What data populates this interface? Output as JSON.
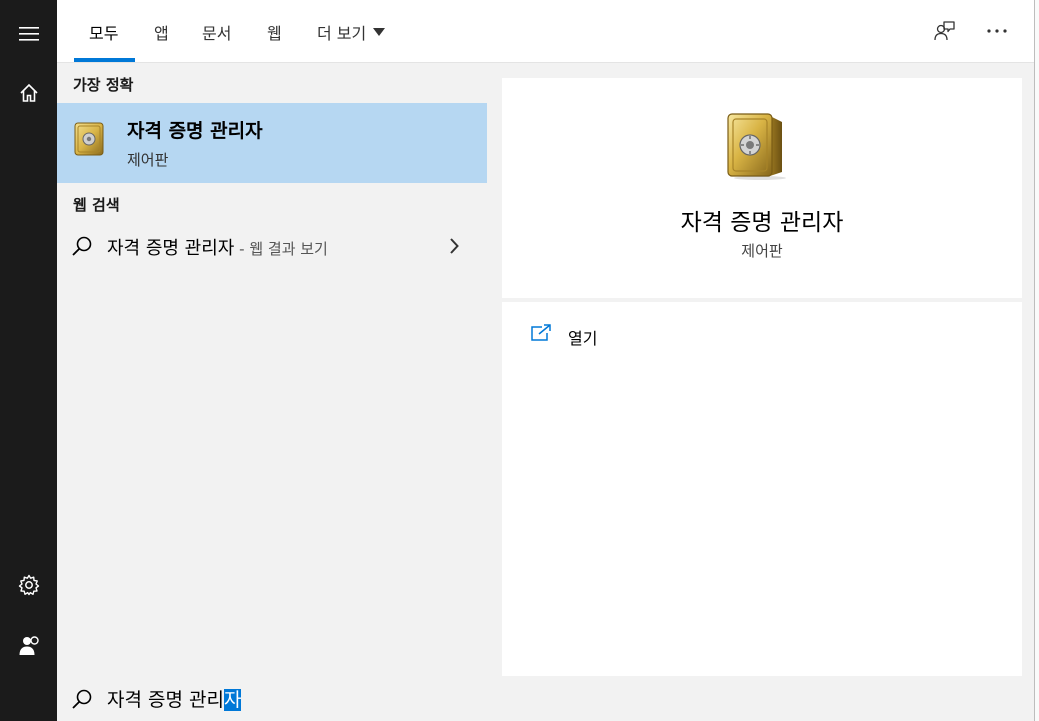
{
  "tabs": [
    {
      "label": "모두"
    },
    {
      "label": "앱"
    },
    {
      "label": "문서"
    },
    {
      "label": "웹"
    },
    {
      "label": "더 보기"
    }
  ],
  "results": {
    "best_match_header": "가장 정확",
    "best_match": {
      "title": "자격 증명 관리자",
      "subtitle": "제어판"
    },
    "web_header": "웹 검색",
    "web_result": {
      "query": "자격 증명 관리자",
      "suffix": " - 웹 결과 보기"
    }
  },
  "detail": {
    "name": "자격 증명 관리자",
    "category": "제어판",
    "actions": [
      {
        "label": "열기"
      }
    ]
  },
  "search": {
    "query_prefix": "자격 증명 관리",
    "query_selected": "자"
  },
  "colors": {
    "accent": "#0078d7",
    "selected_row": "#b6d7f2",
    "rail": "#1b1b1b"
  },
  "icons": [
    "menu-icon",
    "home-icon",
    "settings-icon",
    "user-icon",
    "feedback-icon",
    "more-icon",
    "safe-icon",
    "search-icon",
    "chevron-right-icon",
    "open-icon",
    "caret-down-icon"
  ]
}
